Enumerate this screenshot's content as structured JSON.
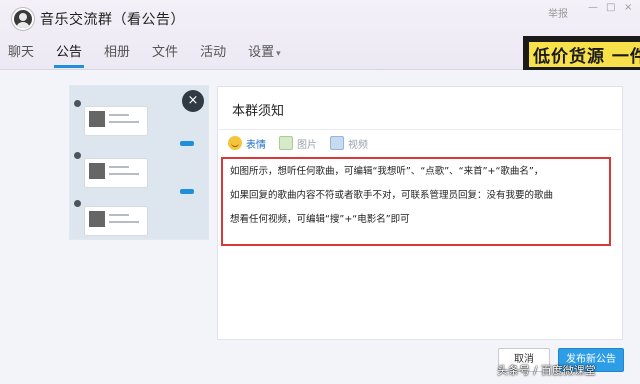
{
  "window": {
    "title": "音乐交流群（看公告）",
    "report_label": "举报",
    "controls": {
      "minimize": "—",
      "maximize": "□",
      "close": "×"
    }
  },
  "tabs": [
    {
      "label": "聊天",
      "active": false
    },
    {
      "label": "公告",
      "active": true
    },
    {
      "label": "相册",
      "active": false
    },
    {
      "label": "文件",
      "active": false
    },
    {
      "label": "活动",
      "active": false
    },
    {
      "label": "设置",
      "active": false,
      "has_dropdown": true
    }
  ],
  "banner": {
    "text": "低价货源 一件"
  },
  "thumbnail": {
    "close_icon": "×"
  },
  "editor": {
    "title": "本群须知",
    "toolbar": [
      {
        "label": "表情",
        "icon": "emoji-icon"
      },
      {
        "label": "图片",
        "icon": "image-icon"
      },
      {
        "label": "视频",
        "icon": "video-icon"
      }
    ],
    "lines": [
      "如图所示，想听任何歌曲，可编辑“我想听”、“点歌”、“来首”+“歌曲名”，",
      "如果回复的歌曲内容不符或者歌手不对，可联系管理员回复：没有我要的歌曲",
      "想看任何视频，可编辑“搜”+“电影名”即可"
    ]
  },
  "buttons": {
    "cancel": "取消",
    "publish": "发布新公告"
  },
  "watermark": "头条号 / 百度微课堂",
  "colors": {
    "accent": "#1f8fd9",
    "highlight_border": "#d83a3a",
    "publish": "#2d9de6"
  }
}
